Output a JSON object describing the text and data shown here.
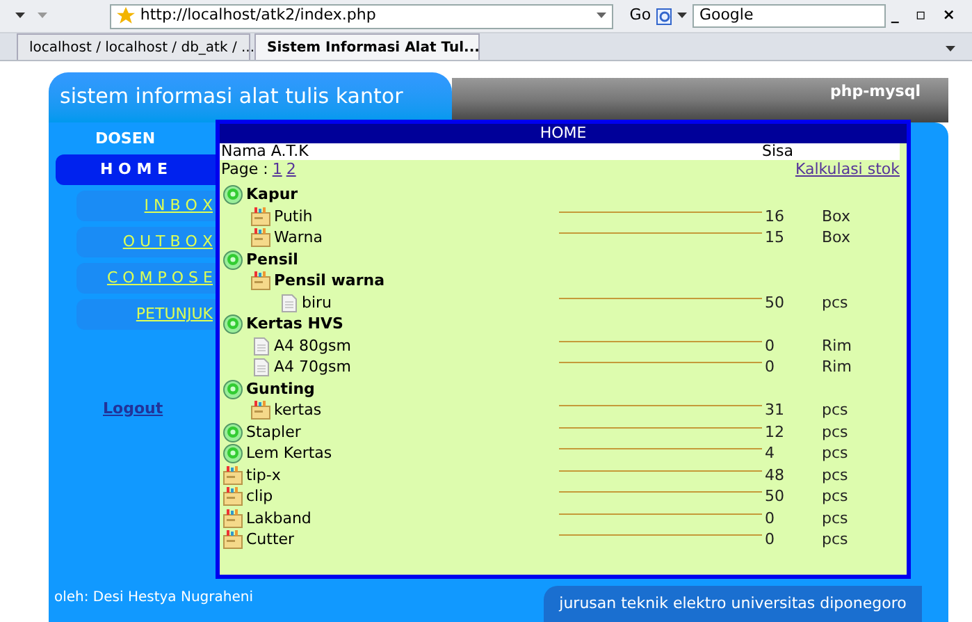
{
  "browser": {
    "url": "http://localhost/atk2/index.php",
    "go_label": "Go",
    "search_value": "Google",
    "window_buttons": [
      "_",
      "▫",
      "×"
    ],
    "tabs": [
      {
        "title": "localhost / localhost / db_atk / ...",
        "selected": false
      },
      {
        "title": "Sistem Informasi Alat Tul...",
        "selected": true
      }
    ]
  },
  "header": {
    "title": "sistem informasi alat tulis kantor",
    "tagline": "php-mysql"
  },
  "sidebar": {
    "heading": "DOSEN",
    "items": [
      {
        "label": "H O M E",
        "kind": "main",
        "selected": true
      },
      {
        "label": "I N B O X",
        "kind": "sub",
        "selected": false
      },
      {
        "label": "O U T B O X",
        "kind": "sub",
        "selected": false
      },
      {
        "label": "C O M P O S E",
        "kind": "sub",
        "selected": false
      },
      {
        "label": "PETUNJUK",
        "kind": "sub",
        "selected": false
      }
    ],
    "logout": "Logout"
  },
  "panel": {
    "title": "HOME",
    "columns": [
      "Nama A.T.K",
      "Sisa"
    ],
    "page_label": "Page :",
    "pages": [
      "1",
      "2"
    ],
    "calc_link": "Kalkulasi stok",
    "tree": [
      {
        "label": "Kapur",
        "kind": "group",
        "children": [
          {
            "label": "Putih",
            "kind": "box",
            "sisa": "16",
            "unit": "Box"
          },
          {
            "label": "Warna",
            "kind": "box",
            "sisa": "15",
            "unit": "Box"
          }
        ]
      },
      {
        "label": "Pensil",
        "kind": "group",
        "children": [
          {
            "label": "Pensil warna",
            "kind": "box",
            "children": [
              {
                "label": "biru",
                "kind": "sheet",
                "sisa": "50",
                "unit": "pcs"
              }
            ]
          }
        ]
      },
      {
        "label": "Kertas HVS",
        "kind": "group",
        "children": [
          {
            "label": "A4 80gsm",
            "kind": "sheet",
            "sisa": "0",
            "unit": "Rim"
          },
          {
            "label": "A4 70gsm",
            "kind": "sheet",
            "sisa": "0",
            "unit": "Rim"
          }
        ]
      },
      {
        "label": "Gunting",
        "kind": "group",
        "children": [
          {
            "label": "kertas",
            "kind": "box",
            "sisa": "31",
            "unit": "pcs"
          }
        ]
      },
      {
        "label": "Stapler",
        "kind": "group",
        "sisa": "12",
        "unit": "pcs"
      },
      {
        "label": "Lem Kertas",
        "kind": "group",
        "sisa": "4",
        "unit": "pcs"
      },
      {
        "label": "tip-x",
        "kind": "box",
        "sisa": "48",
        "unit": "pcs"
      },
      {
        "label": "clip",
        "kind": "box",
        "sisa": "50",
        "unit": "pcs"
      },
      {
        "label": "Lakband",
        "kind": "box",
        "sisa": "0",
        "unit": "pcs"
      },
      {
        "label": "Cutter",
        "kind": "box",
        "sisa": "0",
        "unit": "pcs"
      }
    ]
  },
  "footer": {
    "author": "oleh: Desi Hestya Nugraheni",
    "institution": "jurusan teknik elektro universitas diponegoro"
  }
}
